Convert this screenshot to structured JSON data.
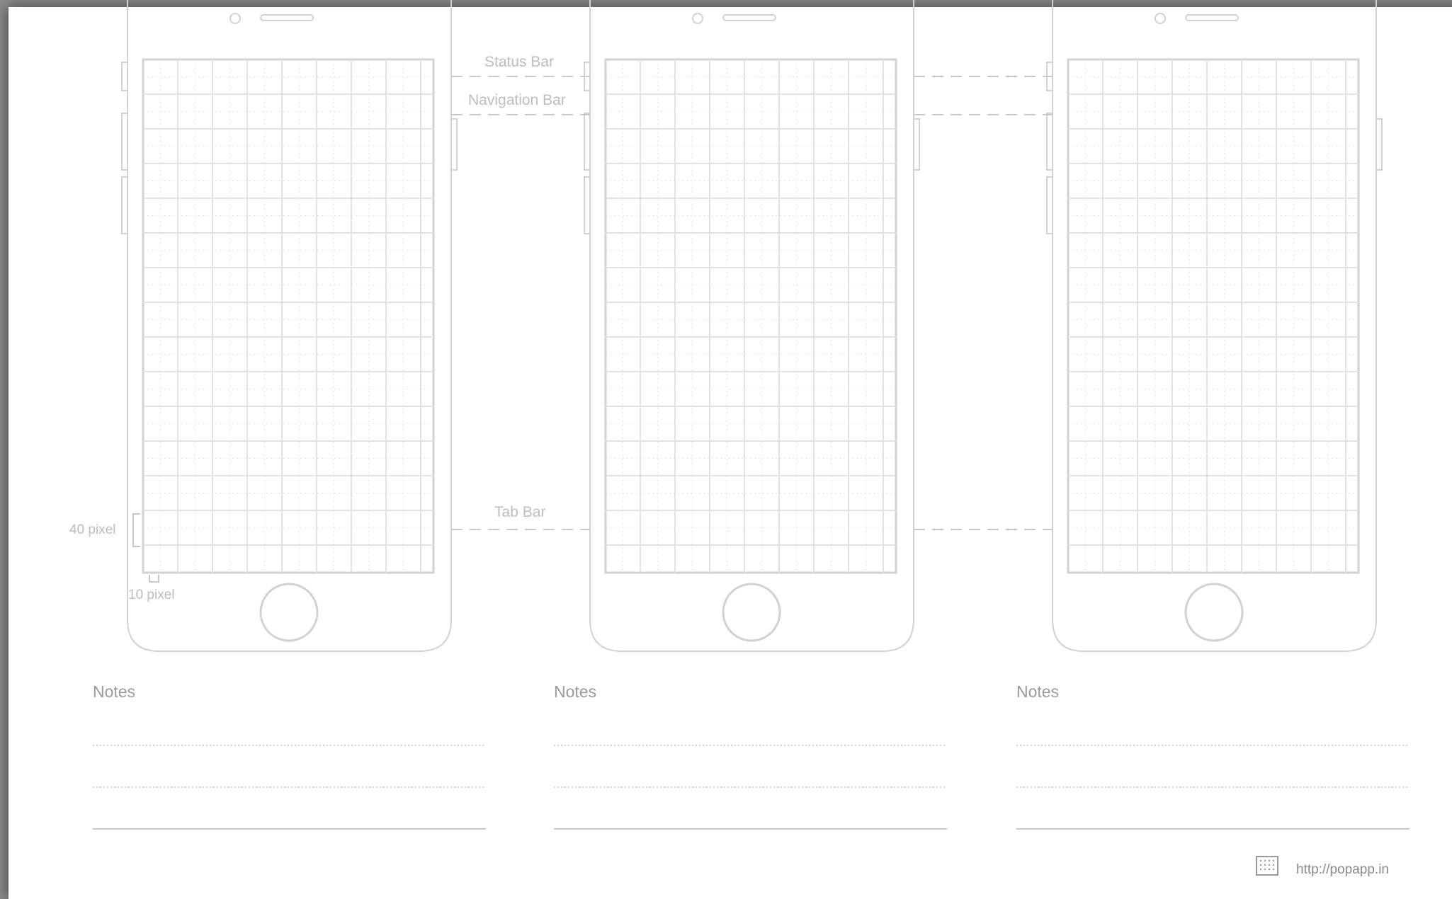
{
  "sheet": {
    "phones": [
      {
        "id": "phone-1"
      },
      {
        "id": "phone-2"
      },
      {
        "id": "phone-3"
      }
    ],
    "annotations": {
      "status_bar": "Status Bar",
      "navigation_bar": "Navigation Bar",
      "tab_bar": "Tab Bar",
      "height_40": "40 pixel",
      "width_10": "10 pixel"
    },
    "notes": [
      {
        "title": "Notes"
      },
      {
        "title": "Notes"
      },
      {
        "title": "Notes"
      }
    ],
    "footer": {
      "url": "http://popapp.in",
      "logo_icon": "popapp-logo-icon"
    },
    "colors": {
      "line": "#d2d2d2",
      "grid": "#e3e3e3",
      "text": "#bdbdbd"
    }
  }
}
